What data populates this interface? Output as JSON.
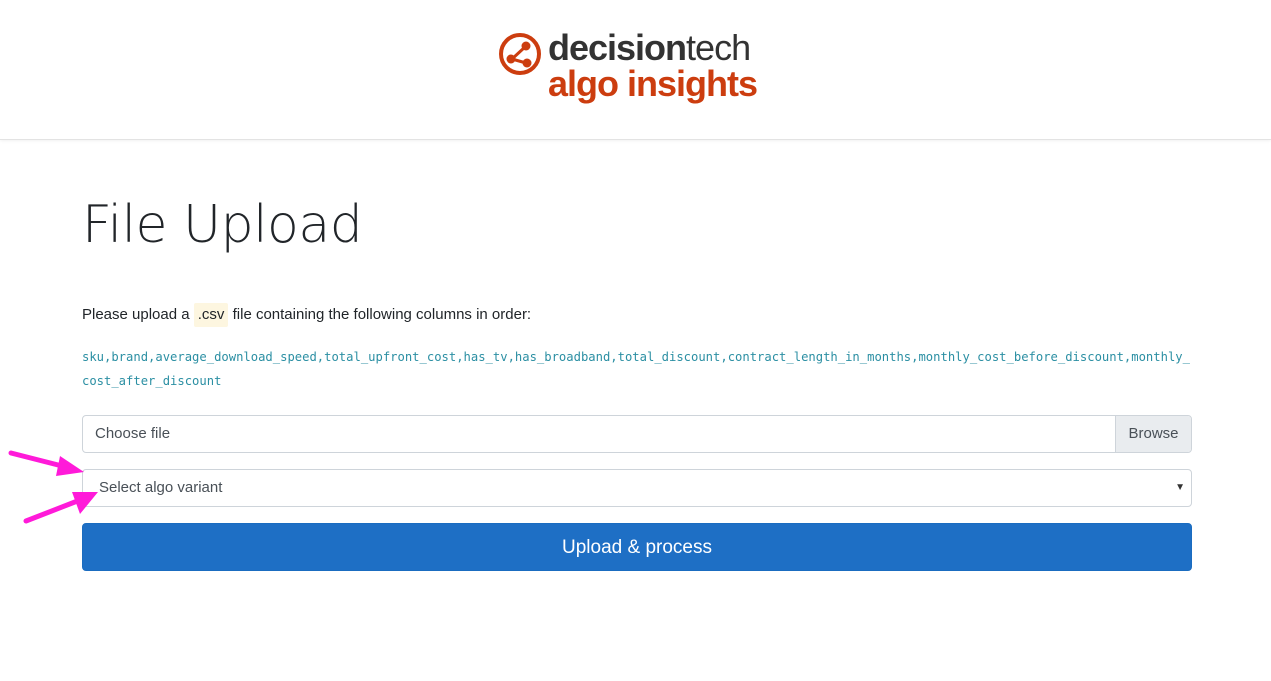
{
  "brand": {
    "name_part1": "decision",
    "name_part2": "tech",
    "tagline": "algo insights",
    "logo_icon": "share-nodes-icon",
    "accent_color": "#cc3d0f"
  },
  "page": {
    "title": "File Upload"
  },
  "instructions": {
    "prefix": "Please upload a ",
    "file_ext": ".csv",
    "suffix": " file containing the following columns in order:",
    "columns": "sku,brand,average_download_speed,total_upfront_cost,has_tv,has_broadband,total_discount,contract_length_in_months,monthly_cost_before_discount,monthly_cost_after_discount"
  },
  "file_input": {
    "placeholder": "Choose file",
    "browse_label": "Browse"
  },
  "variant_select": {
    "selected": "Select algo variant",
    "caret_icon": "caret-down-icon"
  },
  "submit": {
    "label": "Upload & process",
    "color": "#1e6fc5"
  },
  "annotations": {
    "arrow_color": "#ff1ad9"
  }
}
